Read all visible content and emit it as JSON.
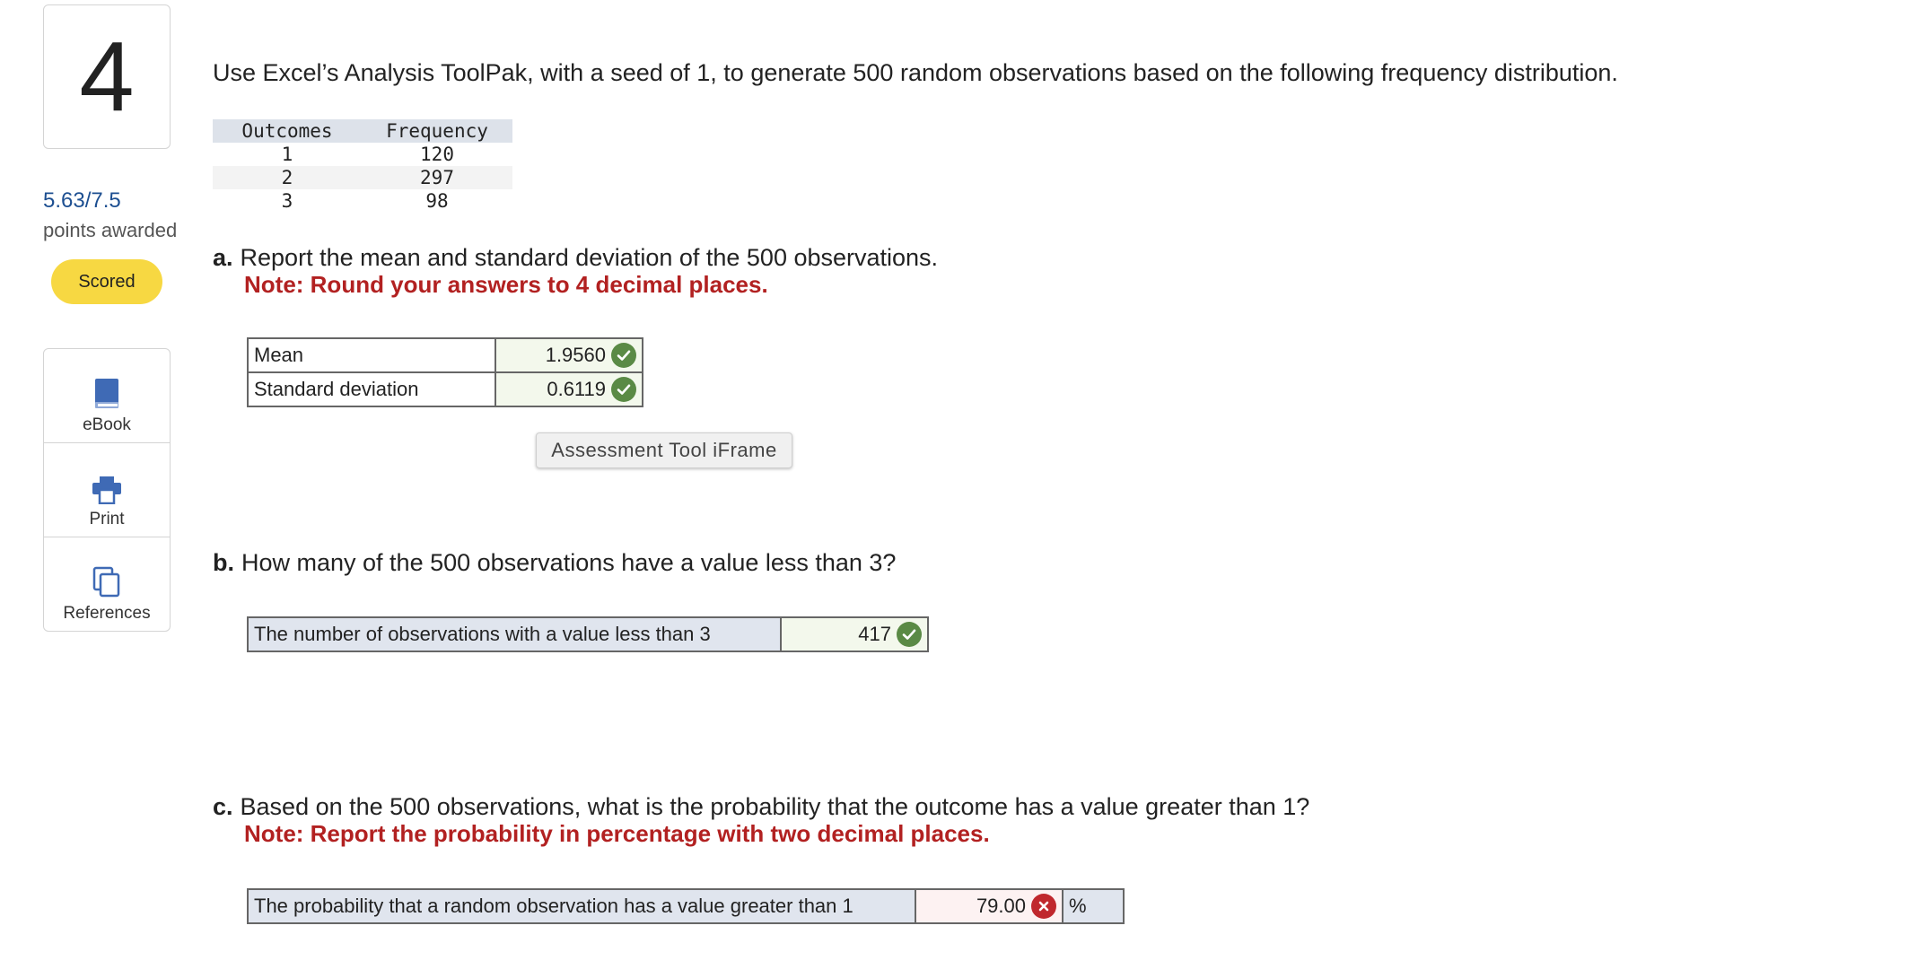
{
  "question": {
    "number": "4",
    "score": "5.63/7.5",
    "points_label": "points awarded",
    "status": "Scored"
  },
  "tools": [
    {
      "label": "eBook",
      "icon": "book-icon"
    },
    {
      "label": "Print",
      "icon": "printer-icon"
    },
    {
      "label": "References",
      "icon": "references-icon"
    }
  ],
  "prompt": "Use Excel’s Analysis ToolPak, with a seed of 1, to generate 500 random observations based on the following frequency distribution.",
  "frequency_table": {
    "headers": [
      "Outcomes",
      "Frequency"
    ],
    "rows": [
      [
        "1",
        "120"
      ],
      [
        "2",
        "297"
      ],
      [
        "3",
        "98"
      ]
    ]
  },
  "part_a": {
    "letter": "a.",
    "text": "Report the mean and standard deviation of the 500 observations.",
    "note": "Note: Round your answers to 4 decimal places.",
    "rows": [
      {
        "label": "Mean",
        "value": "1.9560",
        "status": "correct"
      },
      {
        "label": "Standard deviation",
        "value": "0.6119",
        "status": "correct"
      }
    ]
  },
  "iframe_button": "Assessment Tool iFrame",
  "part_b": {
    "letter": "b.",
    "text": "How many of the 500 observations have a value less than 3?",
    "row": {
      "label": "The number of observations with a value less than 3",
      "value": "417",
      "status": "correct"
    }
  },
  "part_c": {
    "letter": "c.",
    "text": "Based on the 500 observations, what is the probability that the outcome has a value greater than 1?",
    "note": "Note: Report the probability in percentage with two decimal places.",
    "row": {
      "label": "The probability that a random observation has a value greater than 1",
      "value": "79.00",
      "unit": "%",
      "status": "incorrect"
    }
  },
  "colors": {
    "correct": "#5a8a45",
    "incorrect": "#c0282d",
    "note_red": "#b22121",
    "score_blue": "#1d4f91",
    "scored_pill": "#f7d842"
  }
}
